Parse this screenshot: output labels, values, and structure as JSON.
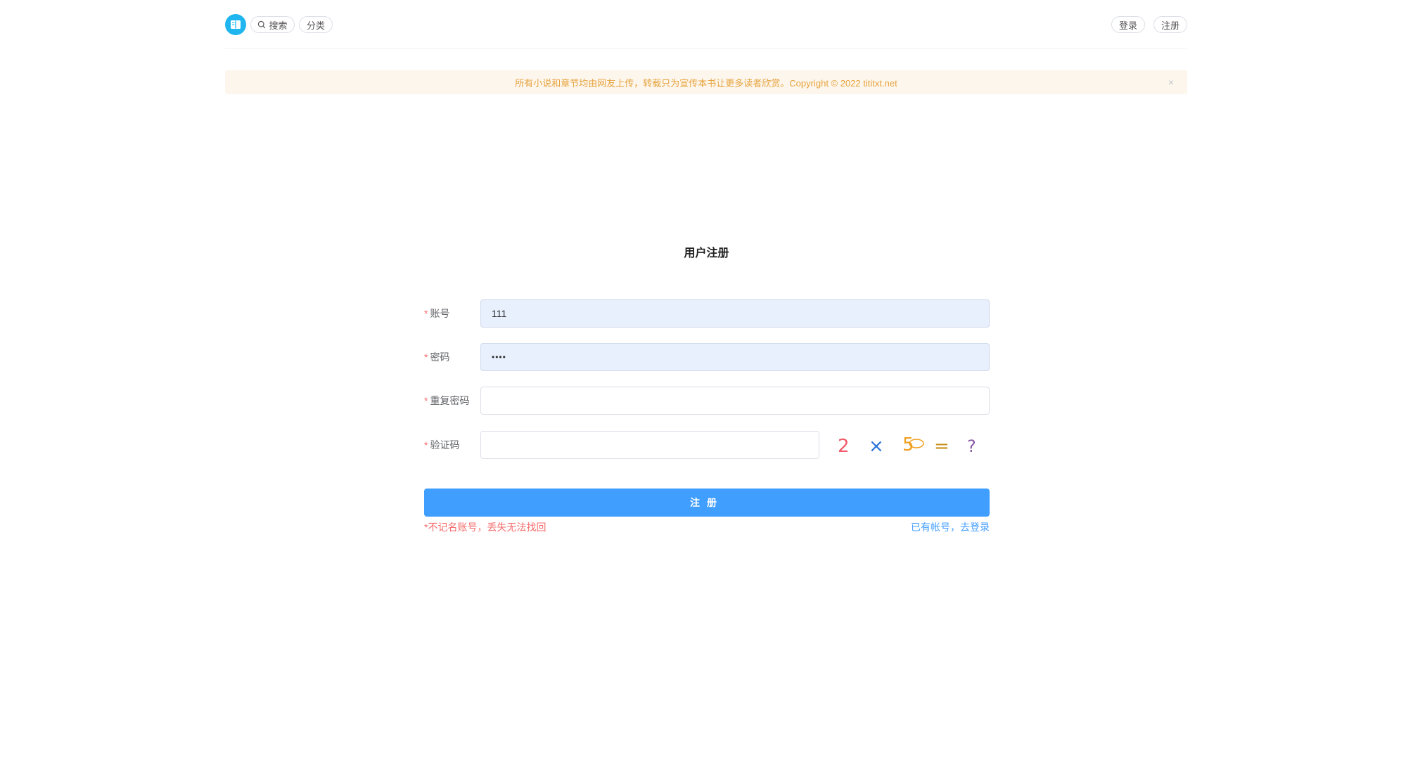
{
  "header": {
    "search_label": "搜索",
    "category_label": "分类",
    "login_label": "登录",
    "register_label": "注册"
  },
  "notice": {
    "text": "所有小说和章节均由网友上传，转载只为宣传本书让更多读者欣赏。Copyright © 2022 tititxt.net"
  },
  "form": {
    "title": "用户注册",
    "fields": [
      {
        "label": "账号",
        "value": "111"
      },
      {
        "label": "密码",
        "value": "••••"
      },
      {
        "label": "重复密码",
        "value": ""
      },
      {
        "label": "验证码",
        "value": ""
      }
    ],
    "required_mark": "*",
    "captcha": {
      "text": "2×5=?",
      "chars": [
        "2",
        "×",
        "5",
        "=",
        "?"
      ]
    },
    "submit_label": "注册",
    "hint": "*不记名账号，丢失无法找回",
    "login_link": "已有帐号，去登录"
  },
  "colors": {
    "primary": "#409eff",
    "danger": "#f56c6c",
    "warning": "#e6a23c",
    "notice_bg": "#fdf6ec",
    "logo": "#1fb6f0"
  }
}
